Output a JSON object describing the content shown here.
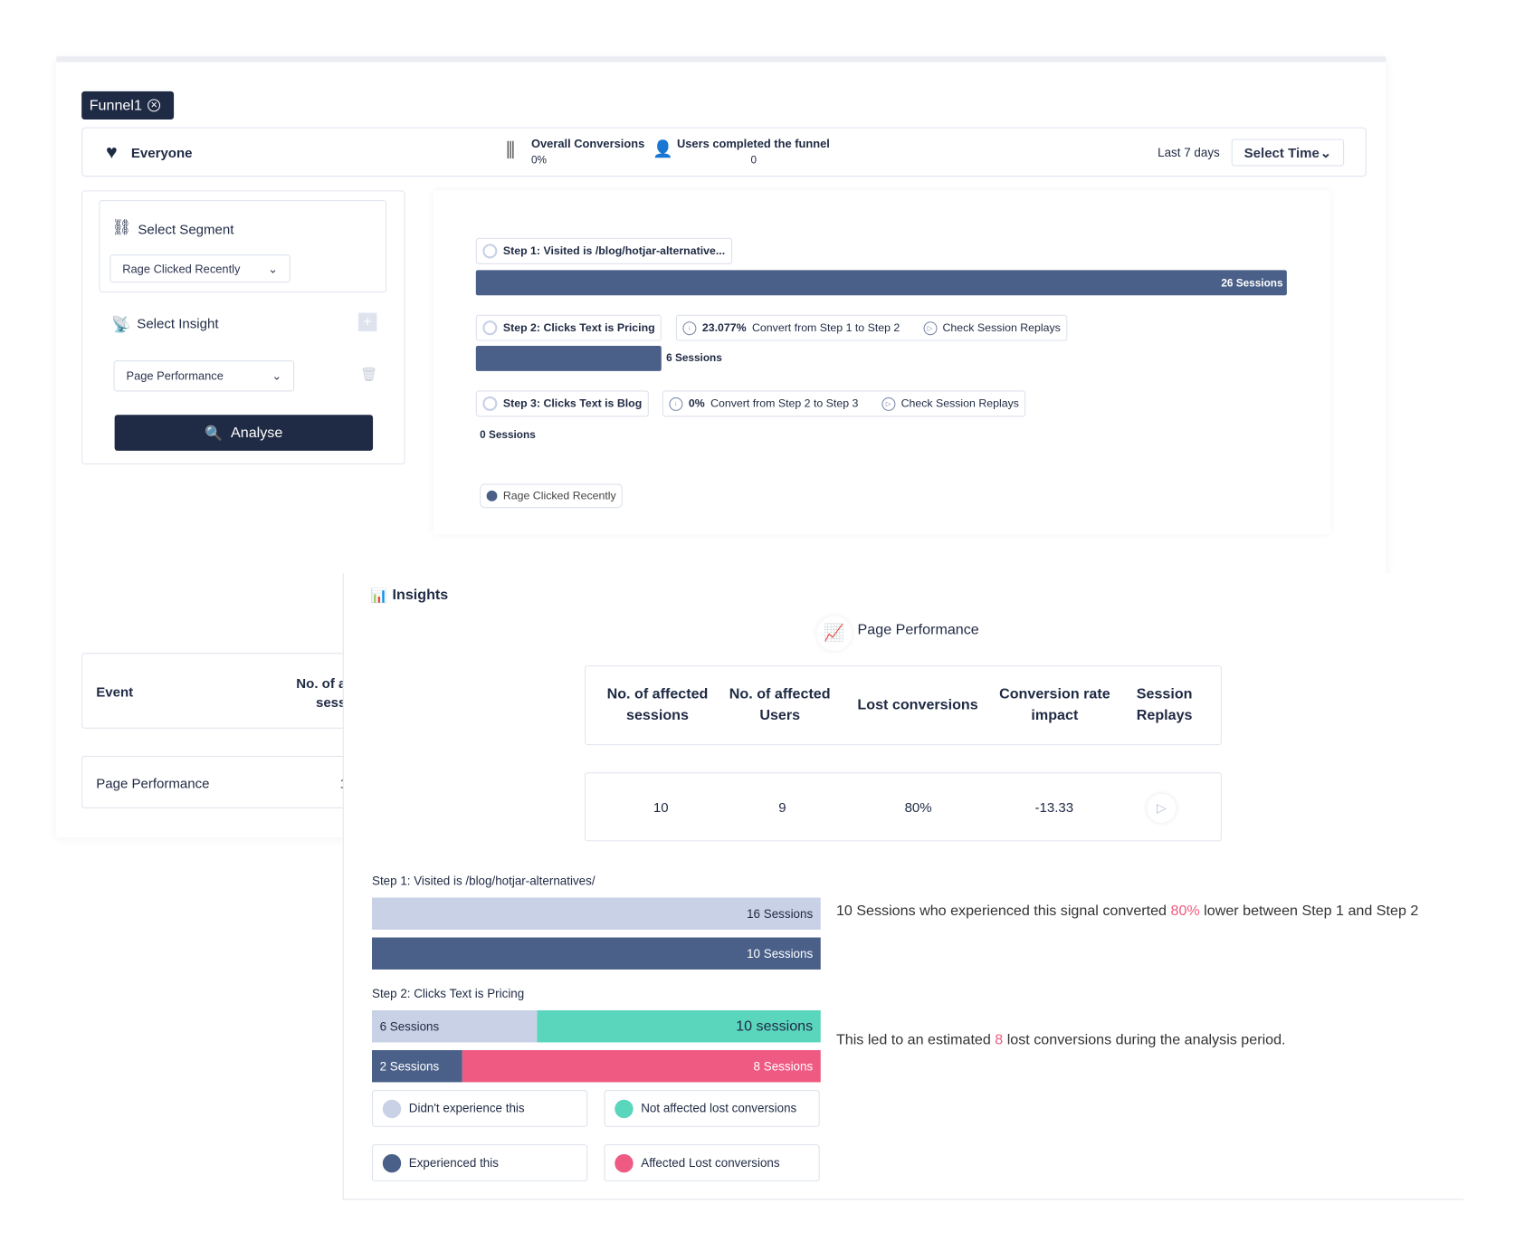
{
  "tab": {
    "label": "Funnel1"
  },
  "header": {
    "segment": "Everyone",
    "overall_label": "Overall Conversions",
    "overall_value": "0%",
    "users_label": "Users completed the funnel",
    "users_value": "0",
    "range": "Last 7 days",
    "select_time": "Select Time"
  },
  "left": {
    "select_segment": "Select Segment",
    "segment_value": "Rage Clicked Recently",
    "select_insight": "Select Insight",
    "insight_value": "Page Performance",
    "analyse": "Analyse"
  },
  "funnel": {
    "steps": [
      {
        "label": "Step 1: Visited is /blog/hotjar-alternative...",
        "sessions": "26 Sessions",
        "value": 26
      },
      {
        "label": "Step 2: Clicks Text is Pricing",
        "sessions": "6 Sessions",
        "value": 6,
        "convert_pct": "23.077%",
        "convert_text": "Convert from Step 1 to Step 2",
        "replays": "Check Session Replays"
      },
      {
        "label": "Step 3: Clicks Text is Blog",
        "sessions": "0 Sessions",
        "value": 0,
        "convert_pct": "0%",
        "convert_text": "Convert from Step 2 to Step 3",
        "replays": "Check Session Replays"
      }
    ],
    "legend": "Rage Clicked Recently"
  },
  "event_table": {
    "col_event": "Event",
    "col_sessions": "No. of a\nsess",
    "row_event": "Page Performance",
    "row_value": "1"
  },
  "insights": {
    "title": "Insights",
    "subtitle": "Page Performance",
    "headers": [
      "No. of affected sessions",
      "No. of affected Users",
      "Lost conversions",
      "Conversion rate impact",
      "Session Replays"
    ],
    "row": [
      "10",
      "9",
      "80%",
      "-13.33"
    ],
    "step1_label": "Step 1: Visited is /blog/hotjar-alternatives/",
    "step1_bars": [
      "16 Sessions",
      "10 Sessions"
    ],
    "step2_label": "Step 2: Clicks Text is Pricing",
    "step2_top": [
      "6 Sessions",
      "10 sessions"
    ],
    "step2_bottom": [
      "2 Sessions",
      "8 Sessions"
    ],
    "msg1_a": "10 Sessions who experienced this signal converted ",
    "msg1_pct": "80%",
    "msg1_b": " lower between Step 1 and Step 2",
    "msg2_a": "This led to an estimated ",
    "msg2_n": "8",
    "msg2_b": " lost conversions during the analysis period.",
    "legend": [
      "Didn't experience this",
      "Not affected lost conversions",
      "Experienced this",
      "Affected Lost conversions"
    ]
  },
  "colors": {
    "dark": "#1f2a44",
    "bar": "#4a6089",
    "light": "#c9d1e6",
    "green": "#5ad6bd",
    "pink": "#ee5a82"
  }
}
